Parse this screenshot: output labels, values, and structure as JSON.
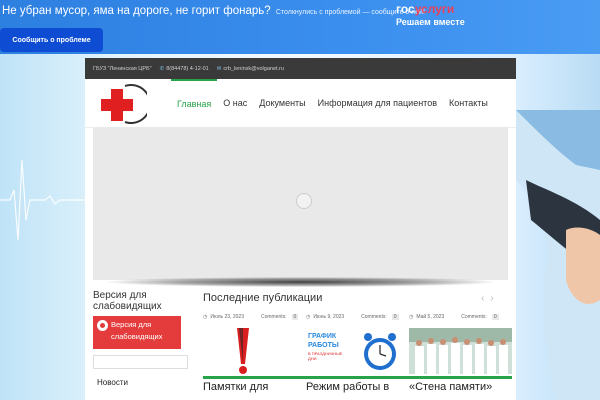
{
  "banner": {
    "headline": "Не убран мусор, яма на дороге, не горит фонарь?",
    "subline": "Столкнулись с проблемой — сообщите о ней!",
    "logo_part1": "гос",
    "logo_part2": "услуги",
    "tagline": "Решаем вместе",
    "report_button": "Сообщить о проблеме"
  },
  "topbar": {
    "org": "ГБУЗ \"Ленинская ЦРБ\"",
    "phone": "8(84478) 4-12-01",
    "email": "crb_leninsk@volganet.ru"
  },
  "nav": {
    "items": [
      {
        "label": "Главная",
        "active": true
      },
      {
        "label": "О нас"
      },
      {
        "label": "Документы"
      },
      {
        "label": "Информация для пациентов"
      },
      {
        "label": "Контакты"
      }
    ]
  },
  "sidebar": {
    "vision_title": "Версия для слабовидящих",
    "vision_button": "Версия для слабовидящих",
    "search_placeholder": "",
    "link_news": "Новости"
  },
  "posts": {
    "section_title": "Последние публикации",
    "comments_label": "Comments:",
    "items": [
      {
        "date": "Июль 23, 2023",
        "comments": "0",
        "title": "Памятки для"
      },
      {
        "date": "Июнь 9, 2023",
        "comments": "0",
        "title": "Режим работы в",
        "thumb_line1": "ГРАФИК",
        "thumb_line2": "РАБОТЫ",
        "thumb_line3": "В ПРАЗДНИЧНЫЕ",
        "thumb_line4": "ДНИ"
      },
      {
        "date": "Май 5, 2023",
        "comments": "0",
        "title": "«Стена памяти»"
      }
    ]
  },
  "colors": {
    "banner_blue": "#3b8fee",
    "button_blue": "#0d4cd3",
    "accent_green": "#27a349",
    "accent_red": "#e43c3c"
  }
}
